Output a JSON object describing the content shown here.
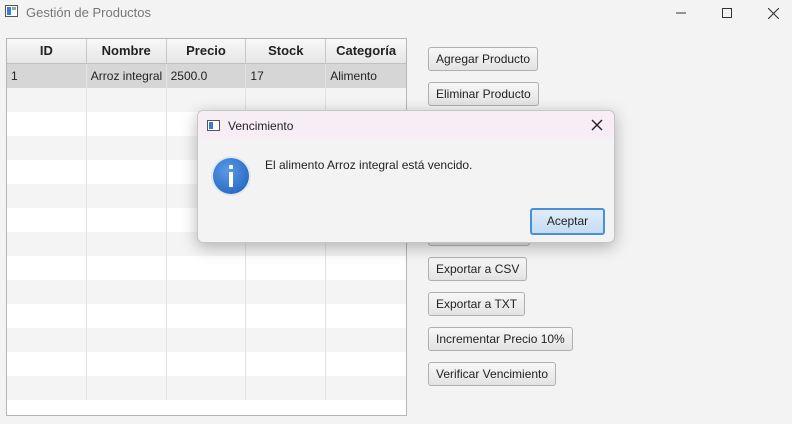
{
  "window": {
    "title": "Gestión de Productos"
  },
  "table": {
    "columns": [
      "ID",
      "Nombre",
      "Precio",
      "Stock",
      "Categoría"
    ],
    "rows": [
      [
        "1",
        "Arroz integral",
        "2500.0",
        "17",
        "Alimento"
      ]
    ]
  },
  "buttons": {
    "add": "Agregar Producto",
    "delete": "Eliminar Producto",
    "export_csv": "Exportar a CSV",
    "export_txt": "Exportar a TXT",
    "increase_price": "Incrementar Precio 10%",
    "check_expiry": "Verificar Vencimiento"
  },
  "dialog": {
    "title": "Vencimiento",
    "message": "El alimento Arroz integral está vencido.",
    "accept": "Aceptar"
  },
  "icons": {
    "app": "app-window-icon",
    "dialog_type": "info-icon",
    "minimize": "minimize-icon",
    "maximize": "maximize-icon",
    "close": "close-icon"
  },
  "colors": {
    "selected_row": "#d6d6d6",
    "default_button_border": "#4a90d9",
    "info_icon": "#1a5cb8"
  }
}
